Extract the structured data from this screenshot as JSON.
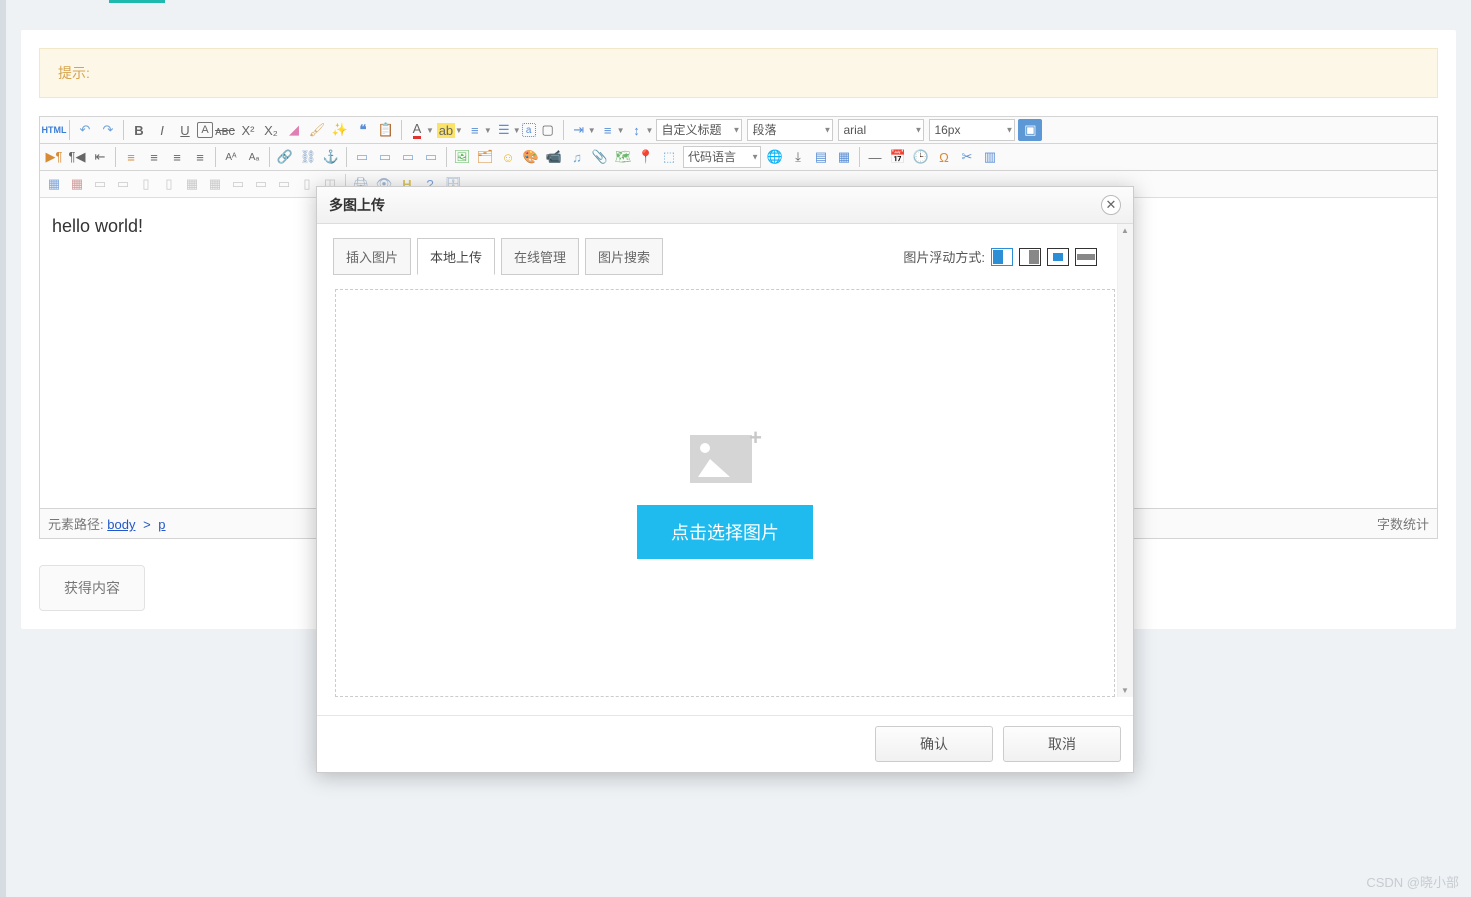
{
  "alert": {
    "label": "提示:"
  },
  "toolbar": {
    "html_label": "HTML",
    "sel_title": "自定义标题",
    "sel_para": "段落",
    "sel_font": "arial",
    "sel_size": "16px",
    "code_lang": "代码语言"
  },
  "editor": {
    "content": "hello world!"
  },
  "status": {
    "path_label": "元素路径:",
    "body": "body",
    "sep": ">",
    "p": "p",
    "wordcount": "字数统计"
  },
  "button": {
    "get_content": "获得内容"
  },
  "dialog": {
    "title": "多图上传",
    "tabs": [
      "插入图片",
      "本地上传",
      "在线管理",
      "图片搜索"
    ],
    "active_tab_index": 1,
    "float_label": "图片浮动方式:",
    "pick_label": "点击选择图片",
    "ok": "确认",
    "cancel": "取消"
  },
  "watermark": "CSDN @晓小部"
}
